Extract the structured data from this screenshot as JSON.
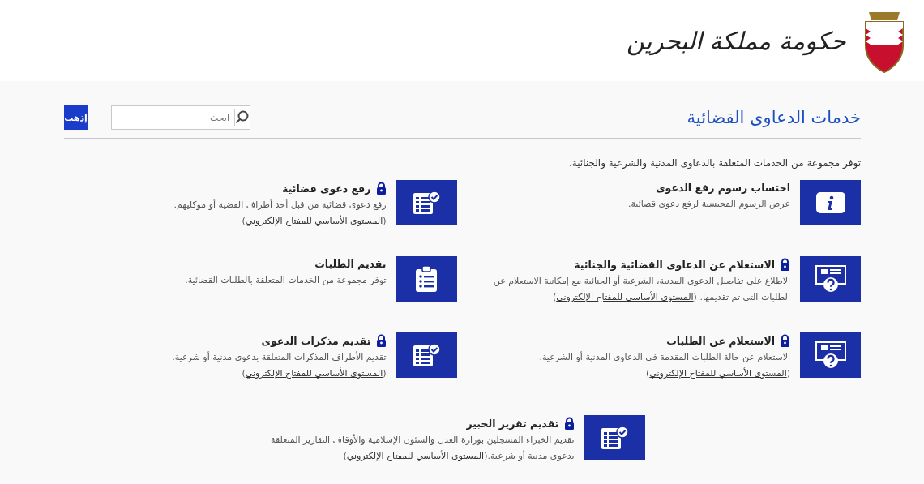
{
  "header": {
    "logo_text": "حكومة مملكة البحرين"
  },
  "page": {
    "title": "خدمات الدعاوى القضائية",
    "search": {
      "placeholder": "ابحث"
    },
    "go_button": "إذهب",
    "intro": "توفر مجموعة من الخدمات المتعلقة بالدعاوى المدنية والشرعية والجنائية."
  },
  "services": [
    {
      "kind": "info",
      "title": "احتساب رسوم رفع الدعوى",
      "locked": false,
      "description": "عرض الرسوم المحتسبة لرفع دعوى قضائية."
    },
    {
      "kind": "form",
      "title": "رفع دعوى قضائية",
      "locked": true,
      "description": "رفع دعوى قضائية من قبل أحد أطراف القضية أو موكليهم.(",
      "link": "المستوى الأساسي للمفتاح الإلكتروني",
      "suffix": ")"
    },
    {
      "kind": "inquiry",
      "title": "الاستعلام عن الدعاوى القضائية والجنائية",
      "locked": true,
      "description": "الاطلاع على تفاصيل الدعوى المدنية، الشرعية أو الجنائية مع إمكانية الاستعلام عن الطلبات التي تم تقديمها. (",
      "link": "المستوى الأساسي للمفتاح الإلكتروني",
      "suffix": ")"
    },
    {
      "kind": "list",
      "title": "تقديم الطلبات",
      "locked": false,
      "description": "توفر مجموعة من الخدمات المتعلقة بالطلبات القضائية."
    },
    {
      "kind": "inquiry",
      "title": "الاستعلام عن الطلبات",
      "locked": true,
      "description": "الاستعلام عن حالة الطلبات المقدمة في الدعاوى المدنية أو الشرعية.(",
      "link": "المستوى الأساسي للمفتاح الإلكتروني",
      "suffix": ")"
    },
    {
      "kind": "form",
      "title": "تقديم مذكرات الدعوى",
      "locked": true,
      "description": "تقديم الأطراف المذكرات المتعلقة بدعوى مدنية أو شرعية.(",
      "link": "المستوى الأساسي للمفتاح الإلكتروني",
      "suffix": ")"
    },
    {
      "kind": "form",
      "title": "تقديم تقرير الخبير",
      "locked": true,
      "description": "تقديم الخبراء المسجلين بوزارة العدل والشئون الإسلامية والأوقاف التقارير المتعلقة بدعوى مدنية أو شرعية.(",
      "link": "المستوى الأساسي للمفتاح الإلكتروني",
      "suffix": ")"
    }
  ]
}
